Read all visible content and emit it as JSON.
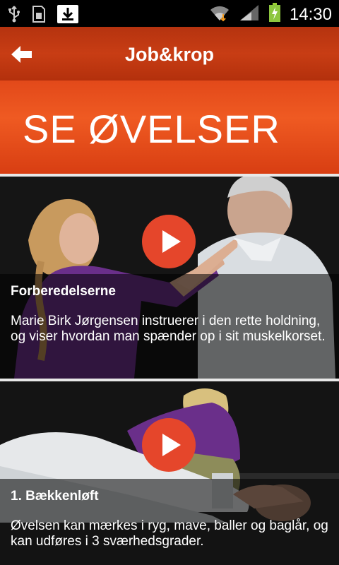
{
  "statusbar": {
    "time": "14:30",
    "icons": [
      "usb-icon",
      "sd-card-icon",
      "download-icon",
      "wifi-icon",
      "signal-icon",
      "battery-charging-icon"
    ]
  },
  "appbar": {
    "title": "Job&krop",
    "back_icon": "back-arrow-icon"
  },
  "hero": {
    "title": "SE ØVELSER"
  },
  "videos": [
    {
      "title": "Forberedelserne",
      "description": "Marie Birk Jørgensen instruerer i den rette holdning, og viser hvordan man spænder op i sit muskelkorset.",
      "play_icon": "play-icon"
    },
    {
      "title": "1. Bækkenløft",
      "description": "Øvelsen kan mærkes i ryg, mave, baller og baglår, og kan udføres i 3 sværhedsgrader.",
      "play_icon": "play-icon"
    }
  ],
  "colors": {
    "appbar": "#c03a12",
    "hero": "#e84f1d",
    "play_button": "#e5462b"
  }
}
